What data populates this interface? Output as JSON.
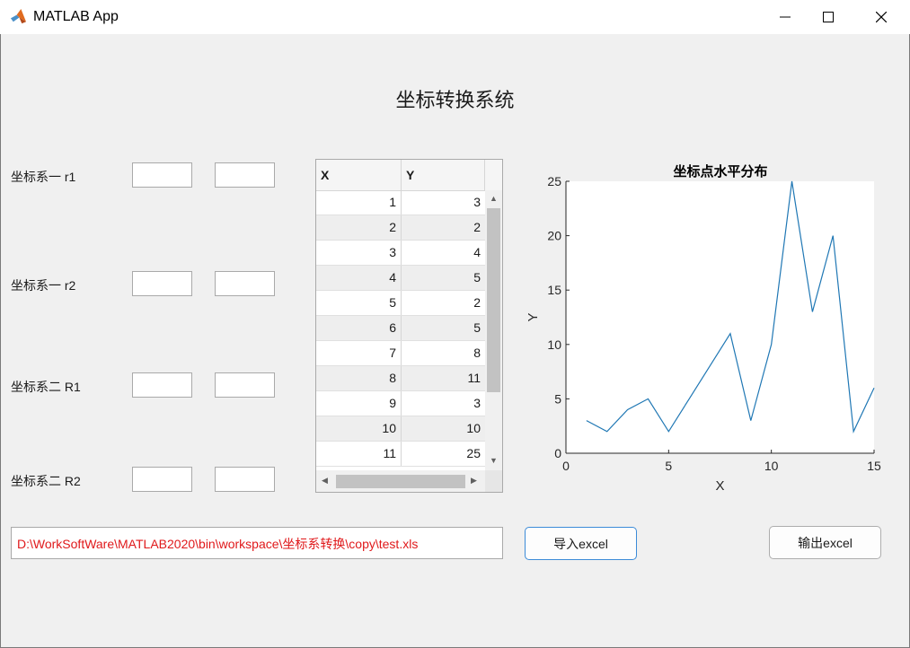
{
  "window": {
    "title": "MATLAB App",
    "icons": [
      "matlab-logo-icon",
      "minimize-icon",
      "maximize-icon",
      "close-icon"
    ]
  },
  "heading": "坐标转换系统",
  "inputs": [
    {
      "label": "坐标系一  r1",
      "values": [
        "",
        ""
      ]
    },
    {
      "label": "坐标系一  r2",
      "values": [
        "",
        ""
      ]
    },
    {
      "label": "坐标系二  R1",
      "values": [
        "",
        ""
      ]
    },
    {
      "label": "坐标系二  R2",
      "values": [
        "",
        ""
      ]
    }
  ],
  "table": {
    "columns": [
      "X",
      "Y"
    ],
    "rows": [
      [
        "1",
        "3"
      ],
      [
        "2",
        "2"
      ],
      [
        "3",
        "4"
      ],
      [
        "4",
        "5"
      ],
      [
        "5",
        "2"
      ],
      [
        "6",
        "5"
      ],
      [
        "7",
        "8"
      ],
      [
        "8",
        "11"
      ],
      [
        "9",
        "3"
      ],
      [
        "10",
        "10"
      ],
      [
        "11",
        "25"
      ]
    ]
  },
  "file_path": "D:\\WorkSoftWare\\MATLAB2020\\bin\\workspace\\坐标系转换\\copy\\test.xls",
  "buttons": {
    "import": "导入excel",
    "export": "输出excel"
  },
  "colors": {
    "line": "#1f77b4",
    "path_text": "#e0191b",
    "import_border": "#3c8bd8"
  },
  "chart_data": {
    "type": "line",
    "title": "坐标点水平分布",
    "xlabel": "X",
    "ylabel": "Y",
    "xlim": [
      0,
      15
    ],
    "ylim": [
      0,
      25
    ],
    "xticks": [
      "0",
      "5",
      "10",
      "15"
    ],
    "yticks": [
      "0",
      "5",
      "10",
      "15",
      "20",
      "25"
    ],
    "grid": false,
    "series": [
      {
        "x": [
          1,
          2,
          3,
          4,
          5,
          6,
          7,
          8,
          9,
          10,
          11,
          12,
          13,
          14,
          15
        ],
        "y": [
          3,
          2,
          4,
          5,
          2,
          5,
          8,
          11,
          3,
          10,
          25,
          13,
          20,
          2,
          6
        ]
      }
    ]
  }
}
